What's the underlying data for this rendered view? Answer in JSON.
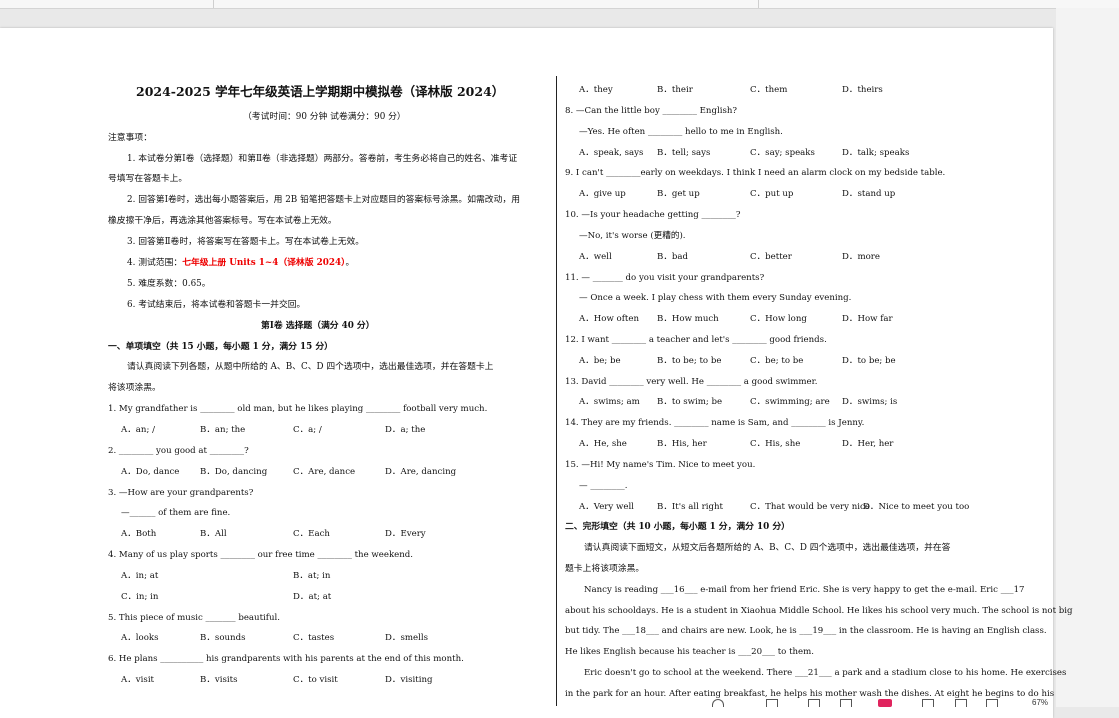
{
  "doc": {
    "title": "2024-2025 学年七年级英语上学期期中模拟卷（译林版 2024）",
    "subtitle": "（考试时间：90 分钟   试卷满分：90 分）",
    "notice_heading": "注意事项：",
    "notices": [
      "1. 本试卷分第Ⅰ卷（选择题）和第Ⅱ卷（非选择题）两部分。答卷前，考生务必将自己的姓名、准考证",
      "号填写在答题卡上。",
      "2. 回答第Ⅰ卷时，选出每小题答案后，用 2B 铅笔把答题卡上对应题目的答案标号涂黑。如需改动，用",
      "橡皮擦干净后，再选涂其他答案标号。写在本试卷上无效。",
      "3. 回答第Ⅱ卷时，将答案写在答题卡上。写在本试卷上无效。",
      "4. 测试范围：",
      "七年级上册 Units 1~4（译林版 2024）",
      "。",
      "5. 难度系数：0.65。",
      "6. 考试结束后，将本试卷和答题卡一并交回。"
    ],
    "part1_heading": "第Ⅰ卷  选择题（满分 40 分）",
    "section1_heading": "一、单项填空（共 15 小题，每小题 1 分，满分 15 分）",
    "section1_instr": [
      "请认真阅读下列各题，从题中所给的 A、B、C、D 四个选项中，选出最佳选项，并在答题卡上",
      "将该项涂黑。"
    ],
    "left_lines": [
      "1.  My grandfather is ________ old man, but he likes playing ________ football very much.",
      "A．an; /",
      "B．an; the",
      "C．a; /",
      "D．a; the",
      "2. ________ you good at ________?",
      "A．Do, dance",
      "B．Do, dancing",
      "C．Are, dance",
      "D．Are, dancing",
      "3. —How are your grandparents?",
      "—______ of them are fine.",
      "A．Both",
      "B．All",
      "C．Each",
      "D．Every",
      "4.  Many of us play sports ________ our free time ________ the weekend.",
      "A．in; at",
      "B．at; in",
      "C．in; in",
      "D．at; at",
      "5.  This piece of music _______ beautiful.",
      "A．looks",
      "B．sounds",
      "C．tastes",
      "D．smells",
      "6.  He plans __________ his grandparents with his parents at the end of this month.",
      "A．visit",
      "B．visits",
      "C．to visit",
      "D．visiting"
    ],
    "right_lines": [
      "A．they",
      "B．their",
      "C．them",
      "D．theirs",
      "8.  —Can the little boy ________ English?",
      "—Yes. He often ________ hello to me in English.",
      "A．speak, says",
      "B．tell; says",
      "C．say; speaks",
      "D．talk; speaks",
      "9.  I can't ________early on weekdays. I think I need an alarm clock on my bedside table.",
      "A．give up",
      "B．get up",
      "C．put up",
      "D．stand up",
      "10.  —Is your headache getting ________?",
      "—No, it's worse (更糟的).",
      "A．well",
      "B．bad",
      "C．better",
      "D．more",
      "11.  — _______ do you visit your grandparents?",
      "— Once a week. I play chess with them every Sunday evening.",
      "A．How often",
      "B．How much",
      "C．How long",
      "D．How far",
      "12.  I want ________ a teacher and let's ________ good friends.",
      "A．be; be",
      "B．to be; to be",
      "C．be; to be",
      "D．to be; be",
      "13.  David ________ very well. He ________ a good swimmer.",
      "A．swims; am",
      "B．to swim; be",
      "C．swimming; are",
      "D．swims; is",
      "14.  They are my friends. ________ name is Sam, and ________ is Jenny.",
      "A．He, she",
      "B．His, her",
      "C．His, she",
      "D．Her, her",
      "15.  —Hi! My name's Tim. Nice to meet you.",
      "— ________.",
      "A．Very well",
      "B．It's all right",
      "C．That would be very nice",
      "D．Nice to meet you too",
      "二、完形填空（共 10 小题，每小题 1 分，满分 10 分）",
      "请认真阅读下面短文，从短文后各题所给的 A、B、C、D 四个选项中，选出最佳选项，并在答",
      "题卡上将该项涂黑。",
      "Nancy is reading ___16___ e-mail from her friend Eric. She is very happy to get the e-mail. Eric ___17",
      "about his schooldays. He is a student in Xiaohua Middle School. He likes his school very much. The school is not big",
      "but tidy. The ___18___ and chairs are new. Look, he is ___19___ in the classroom. He is having an English class.",
      "He likes English because his teacher is ___20___ to them.",
      "Eric doesn't go to school at the weekend. There ___21___ a park and a stadium close to his home. He exercises",
      "in the park for an hour. After eating breakfast, he helps his mother wash the dishes. At eight he begins to do his"
    ],
    "zoom": "67%"
  },
  "colors": {
    "highlight": "#e00000",
    "page": "#ffffff",
    "background": "#e9e9e9"
  }
}
